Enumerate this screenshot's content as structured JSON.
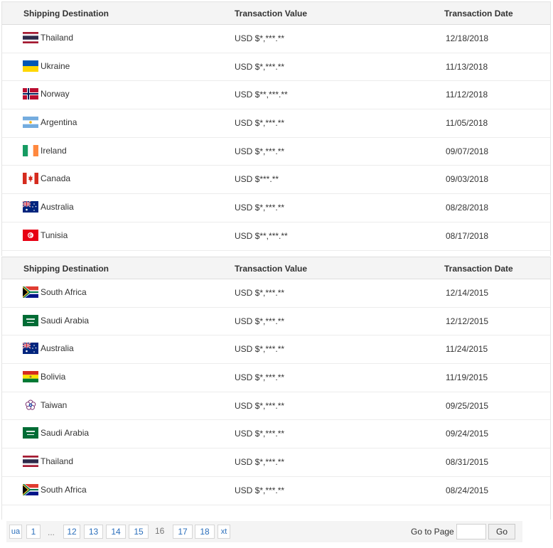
{
  "table1": {
    "headers": {
      "destination": "Shipping Destination",
      "value": "Transaction Value",
      "date": "Transaction Date"
    },
    "rows": [
      {
        "country": "Thailand",
        "flag": "thailand-flag-icon",
        "value": "USD $*,***.**",
        "date": "12/18/2018"
      },
      {
        "country": "Ukraine",
        "flag": "ukraine-flag-icon",
        "value": "USD $*,***.**",
        "date": "11/13/2018"
      },
      {
        "country": "Norway",
        "flag": "norway-flag-icon",
        "value": "USD $**,***.**",
        "date": "11/12/2018"
      },
      {
        "country": "Argentina",
        "flag": "argentina-flag-icon",
        "value": "USD $*,***.**",
        "date": "11/05/2018"
      },
      {
        "country": "Ireland",
        "flag": "ireland-flag-icon",
        "value": "USD $*,***.**",
        "date": "09/07/2018"
      },
      {
        "country": "Canada",
        "flag": "canada-flag-icon",
        "value": "USD $***.**",
        "date": "09/03/2018"
      },
      {
        "country": "Australia",
        "flag": "australia-flag-icon",
        "value": "USD $*,***.**",
        "date": "08/28/2018"
      },
      {
        "country": "Tunisia",
        "flag": "tunisia-flag-icon",
        "value": "USD $**,***.**",
        "date": "08/17/2018"
      }
    ]
  },
  "table2": {
    "headers": {
      "destination": "Shipping Destination",
      "value": "Transaction Value",
      "date": "Transaction Date"
    },
    "rows": [
      {
        "country": "South Africa",
        "flag": "south-africa-flag-icon",
        "value": "USD $*,***.**",
        "date": "12/14/2015"
      },
      {
        "country": "Saudi Arabia",
        "flag": "saudi-arabia-flag-icon",
        "value": "USD $*,***.**",
        "date": "12/12/2015"
      },
      {
        "country": "Australia",
        "flag": "australia-flag-icon",
        "value": "USD $*,***.**",
        "date": "11/24/2015"
      },
      {
        "country": "Bolivia",
        "flag": "bolivia-flag-icon",
        "value": "USD $*,***.**",
        "date": "11/19/2015"
      },
      {
        "country": "Taiwan",
        "flag": "taiwan-plum-blossom-icon",
        "value": "USD $*,***.**",
        "date": "09/25/2015"
      },
      {
        "country": "Saudi Arabia",
        "flag": "saudi-arabia-flag-icon",
        "value": "USD $*,***.**",
        "date": "09/24/2015"
      },
      {
        "country": "Thailand",
        "flag": "thailand-flag-icon",
        "value": "USD $*,***.**",
        "date": "08/31/2015"
      },
      {
        "country": "South Africa",
        "flag": "south-africa-flag-icon",
        "value": "USD $*,***.**",
        "date": "08/24/2015"
      }
    ]
  },
  "pagination": {
    "prev_label": "ua",
    "first_page": "1",
    "ellipsis": "...",
    "pages": [
      "12",
      "13",
      "14",
      "15"
    ],
    "current_page": "16",
    "next_pages": [
      "17",
      "18"
    ],
    "next_label": "xt",
    "goto_label": "Go to Page",
    "goto_value": "",
    "go_button": "Go"
  },
  "colors": {
    "header_bg": "#f4f4f4",
    "link_blue": "#2a6ebb",
    "row_border": "#ececec"
  }
}
